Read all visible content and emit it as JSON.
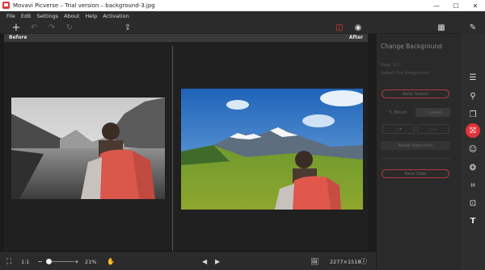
{
  "window": {
    "title": "Movavi Picverse – Trial version – background-3.jpg",
    "minimize": "—",
    "maximize": "☐",
    "close": "✕"
  },
  "menu": [
    "File",
    "Edit",
    "Settings",
    "About",
    "Help",
    "Activation"
  ],
  "toolbar": {
    "add_icon": "+",
    "undo_icon": "↶",
    "redo_icon": "↷",
    "reset_icon": "↻",
    "export_icon": "⇪",
    "compare_icon": "◫",
    "preview_icon": "◉",
    "grid_icon": "▦",
    "edit_icon": "✎"
  },
  "view": {
    "before_label": "Before",
    "after_label": "After"
  },
  "bottom": {
    "fit_icon": "⛶",
    "ratio_label": "1:1",
    "zoom_minus": "−",
    "zoom_plus": "+",
    "zoom_value": "21%",
    "zoom_percent": 21,
    "hand_icon": "✋",
    "prev_icon": "◀",
    "next_icon": "▶",
    "image_icon": "🖼",
    "dimensions": "2277×1518",
    "info_icon": "ⓘ"
  },
  "panel": {
    "title": "Change Background",
    "step": "Step 1/2",
    "step_desc": "Select the foreground",
    "auto_select": "Auto Select",
    "brush_label": "Brush",
    "lasso_label": "Lasso",
    "plus_label": "+",
    "minus_label": "−",
    "reset_selection": "Reset Selection",
    "next_step": "Next Step"
  },
  "rail": {
    "adjust_icon": "☰",
    "stamp_icon": "⚲",
    "layers_icon": "❐",
    "background_icon": "⛝",
    "face_icon": "☺",
    "filters_icon": "❂",
    "crop_icon": "⌗",
    "transform_icon": "⊡",
    "text_icon": "T"
  },
  "colors": {
    "accent": "#e3343a",
    "panel_bg": "#2a2a2a",
    "canvas_bg": "#202020"
  }
}
